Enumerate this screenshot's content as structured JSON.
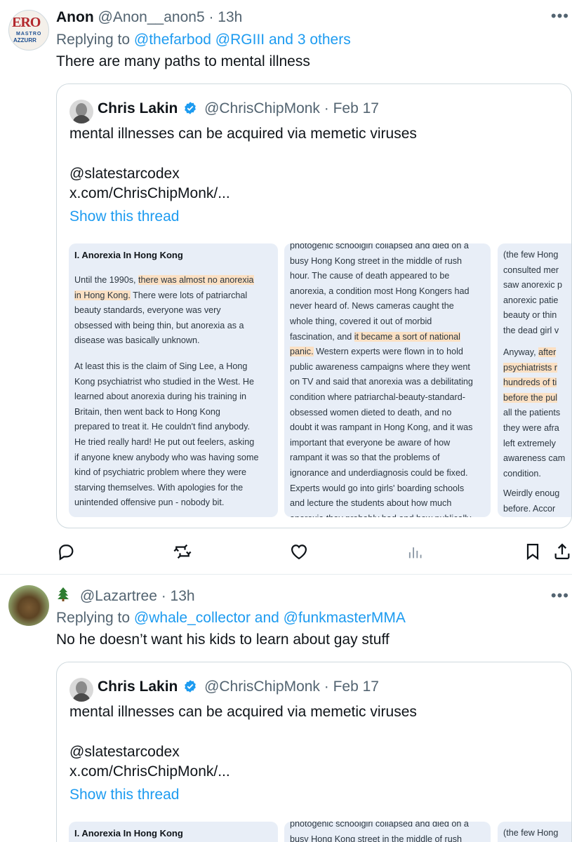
{
  "tweets": [
    {
      "avatar_icon": "mastro-azzurro-logo",
      "avatar_text": [
        "ERO",
        "MASTRO",
        "AZZURR"
      ],
      "name": "Anon",
      "handle": "@Anon__anon5",
      "time": "· 13h",
      "reply_prefix": "Replying to",
      "reply_mentions": "@thefarbod @RGIII and 3 others",
      "text": "There are many paths to mental illness",
      "more_icon": "…"
    },
    {
      "avatar_icon": "squirrel-photo",
      "name_emoji": "tree-emoji",
      "handle": "@Lazartree",
      "time": "· 13h",
      "reply_prefix": "Replying to",
      "reply_mentions": "@whale_collector and @funkmasterMMA",
      "text": "No he doesn’t want his kids to learn about gay stuff",
      "more_icon": "…"
    }
  ],
  "quote": {
    "name": "Chris Lakin",
    "handle": "@ChrisChipMonk",
    "time": "· Feb 17",
    "text": "mental illnesses can be acquired via memetic viruses",
    "mention": "@slatestarcodex",
    "link": "x.com/ChrisChipMonk/...",
    "show_thread": "Show this thread",
    "card1": {
      "title": "I. Anorexia In Hong Kong",
      "para1": [
        [
          "Until the 1990s, ",
          "there was almost no anorexia"
        ],
        [
          "",
          "in Hong Kong.",
          " There were lots of patriarchal"
        ],
        [
          "beauty standards, everyone was very"
        ],
        [
          "obsessed with being thin, but anorexia as a"
        ],
        [
          "disease was basically unknown."
        ]
      ],
      "para2": [
        "At least this is the claim of Sing Lee, a Hong",
        "Kong psychiatrist who studied in the West. He",
        "learned about anorexia during his training in",
        "Britain, then went back to Hong Kong",
        "prepared to treat it. He couldn't find anybody.",
        "He tried really hard! He put out feelers, asking",
        "if anyone knew anybody who was having some",
        "kind of psychiatric problem where they were",
        "starving themselves. With apologies for the",
        "unintended offensive pun - nobody bit."
      ]
    },
    "card2": {
      "lines": [
        "photogenic schoolgirl collapsed and died on a",
        "busy Hong Kong street in the middle of rush",
        "hour. The cause of death appeared to be",
        "anorexia, a condition most Hong Kongers had",
        "never heard of. News cameras caught the",
        "whole thing, covered it out of morbid"
      ],
      "hl_line_a_pre": "fascination, and ",
      "hl_line_a_hl": "it became a sort of national",
      "hl_line_b_hl": "panic.",
      "hl_line_b_post": " Western experts were flown in to hold",
      "lines2": [
        "public awareness campaigns where they went",
        "on TV and said that anorexia was a debilitating",
        "condition where patriarchal-beauty-standard-",
        "obsessed women dieted to death, and no",
        "doubt it was rampant in Hong Kong, and it was",
        "important that everyone be aware of how",
        "rampant it was so that the problems of",
        "ignorance and underdiagnosis could be fixed.",
        "Experts would go into girls' boarding schools",
        "and lecture the students about how much",
        "anorexia they probably had and how publically"
      ]
    },
    "card3": {
      "lines1": [
        "(the few Hong",
        "consulted mer",
        "saw anorexic p",
        "anorexic patie",
        "beauty or thin",
        "the dead girl v"
      ],
      "anyway_pre": "Anyway, ",
      "anyway_hl": "after",
      "hl_lines": [
        "psychiatrists r",
        "hundreds of ti",
        "before the pul"
      ],
      "lines2": [
        "all the patients",
        "they were afra",
        "left extremely",
        "awareness cam",
        "condition."
      ],
      "lines3": [
        "Weirdly enoug",
        "before. Accor"
      ]
    }
  },
  "actions": {
    "reply_icon": "reply-icon",
    "retweet_icon": "retweet-icon",
    "like_icon": "heart-icon",
    "views_icon": "views-icon",
    "bookmark_icon": "bookmark-icon",
    "share_icon": "share-icon"
  },
  "colors": {
    "link": "#1d9bf0",
    "muted": "#536471",
    "card_bg": "#e8eef7",
    "highlight": "#fbe0c3",
    "border": "#cfd9de"
  }
}
